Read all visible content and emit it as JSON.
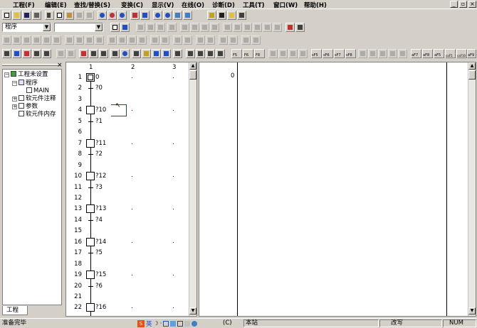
{
  "menu": [
    "工程(F)",
    "编辑(E)",
    "查找/替换(S)",
    "变换(C)",
    "显示(V)",
    "在线(O)",
    "诊断(D)",
    "工具(T)",
    "窗口(W)",
    "帮助(H)"
  ],
  "window_controls": [
    "_",
    "▫",
    "×"
  ],
  "toolbar": {
    "program_select": "程序",
    "second_select": "",
    "fkeys": [
      "F5",
      "F6",
      "F8",
      "sF5",
      "sF6",
      "sF7",
      "sF8",
      "aF7",
      "aF8",
      "aF5",
      "caF5",
      "caF10",
      "aF9"
    ]
  },
  "project_tree": {
    "root": "工程未设置",
    "items": [
      "程序",
      "MAIN",
      "软元件注释",
      "参数",
      "软元件内存"
    ],
    "tab": "工程",
    "close": "×"
  },
  "sfc": {
    "columns": [
      "1",
      "2",
      "3"
    ],
    "rows": [
      {
        "no": "1",
        "type": "step",
        "label": "0"
      },
      {
        "no": "2",
        "type": "trans",
        "label": "?0"
      },
      {
        "no": "3",
        "type": "blank",
        "label": ""
      },
      {
        "no": "4",
        "type": "step",
        "label": "?10"
      },
      {
        "no": "5",
        "type": "trans",
        "label": "?1"
      },
      {
        "no": "6",
        "type": "blank",
        "label": ""
      },
      {
        "no": "7",
        "type": "step",
        "label": "?11"
      },
      {
        "no": "8",
        "type": "trans",
        "label": "?2"
      },
      {
        "no": "9",
        "type": "blank",
        "label": ""
      },
      {
        "no": "10",
        "type": "step",
        "label": "?12"
      },
      {
        "no": "11",
        "type": "trans",
        "label": "?3"
      },
      {
        "no": "12",
        "type": "blank",
        "label": ""
      },
      {
        "no": "13",
        "type": "step",
        "label": "?13"
      },
      {
        "no": "14",
        "type": "trans",
        "label": "?4"
      },
      {
        "no": "15",
        "type": "blank",
        "label": ""
      },
      {
        "no": "16",
        "type": "step",
        "label": "?14"
      },
      {
        "no": "17",
        "type": "trans",
        "label": "?5"
      },
      {
        "no": "18",
        "type": "blank",
        "label": ""
      },
      {
        "no": "19",
        "type": "step",
        "label": "?15"
      },
      {
        "no": "20",
        "type": "trans",
        "label": "?6"
      },
      {
        "no": "21",
        "type": "blank",
        "label": ""
      },
      {
        "no": "22",
        "type": "step",
        "label": "?16"
      }
    ]
  },
  "ladder": {
    "step_no": "0"
  },
  "ime": [
    "英",
    "·",
    "✓"
  ],
  "status": {
    "ready": "准备完毕",
    "ime_label": "(C)",
    "station": "本站",
    "mode": "改写",
    "numlock": "NUM"
  }
}
